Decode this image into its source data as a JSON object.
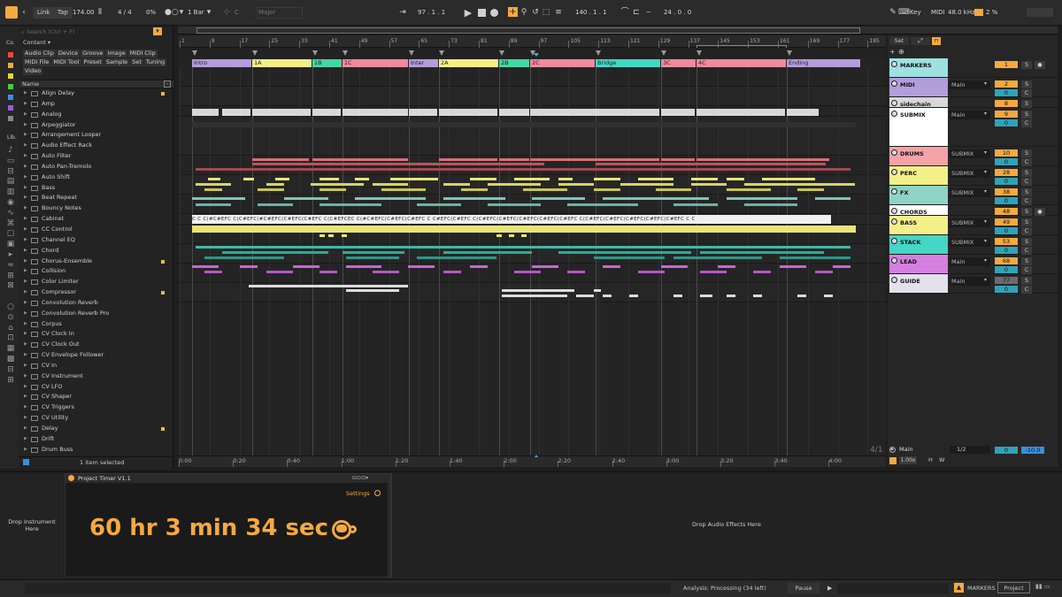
{
  "transport": {
    "link": "Link",
    "tap": "Tap",
    "tempo": "174.00",
    "meter": "4 / 4",
    "cpu": "0%",
    "quantize": "1 Bar",
    "key": "C",
    "scale": "Major",
    "position": "97 .  1 .  1",
    "loop_start": "140 .  1 .  1",
    "loop_length": "24 .  0 .  0",
    "key_label": "Key",
    "midi_label": "MIDI",
    "sample_rate": "48.0 kHz",
    "cpu_load": "2 %"
  },
  "browser": {
    "side_label": "Co.",
    "lib_label": "Lib.",
    "search_placeholder": "Search (Ctrl + F)",
    "content_label": "Content",
    "tags": [
      "Audio Clip",
      "Device",
      "Groove",
      "Image",
      "MIDI Clip",
      "MIDI File",
      "MIDI Tool",
      "Preset",
      "Sample",
      "Set",
      "Tuning",
      "Video"
    ],
    "name_header": "Name",
    "items": [
      {
        "label": "Align Delay",
        "dot": true
      },
      {
        "label": "Amp",
        "dot": false
      },
      {
        "label": "Analog",
        "dot": false
      },
      {
        "label": "Arpeggiator",
        "dot": false
      },
      {
        "label": "Arrangement Looper",
        "dot": false
      },
      {
        "label": "Audio Effect Rack",
        "dot": false
      },
      {
        "label": "Auto Filter",
        "dot": false
      },
      {
        "label": "Auto Pan-Tremolo",
        "dot": false
      },
      {
        "label": "Auto Shift",
        "dot": false
      },
      {
        "label": "Bass",
        "dot": false
      },
      {
        "label": "Beat Repeat",
        "dot": false
      },
      {
        "label": "Bouncy Notes",
        "dot": false
      },
      {
        "label": "Cabinet",
        "dot": false
      },
      {
        "label": "CC Control",
        "dot": false
      },
      {
        "label": "Channel EQ",
        "dot": false
      },
      {
        "label": "Chord",
        "dot": false
      },
      {
        "label": "Chorus-Ensemble",
        "dot": true
      },
      {
        "label": "Collision",
        "dot": false
      },
      {
        "label": "Color Limiter",
        "dot": false
      },
      {
        "label": "Compressor",
        "dot": true
      },
      {
        "label": "Convolution Reverb",
        "dot": false
      },
      {
        "label": "Convolution Reverb Pro",
        "dot": false
      },
      {
        "label": "Corpus",
        "dot": false
      },
      {
        "label": "CV Clock In",
        "dot": false
      },
      {
        "label": "CV Clock Out",
        "dot": false
      },
      {
        "label": "CV Envelope Follower",
        "dot": false
      },
      {
        "label": "CV In",
        "dot": false
      },
      {
        "label": "CV Instrument",
        "dot": false
      },
      {
        "label": "CV LFO",
        "dot": false
      },
      {
        "label": "CV Shaper",
        "dot": false
      },
      {
        "label": "CV Triggers",
        "dot": false
      },
      {
        "label": "CV Utility",
        "dot": false
      },
      {
        "label": "Delay",
        "dot": true
      },
      {
        "label": "Drift",
        "dot": false
      },
      {
        "label": "Drum Buss",
        "dot": false
      }
    ],
    "selected_status": "1 item selected"
  },
  "ruler": {
    "bars": [
      "1",
      "9",
      "17",
      "25",
      "33",
      "41",
      "49",
      "57",
      "65",
      "73",
      "81",
      "89",
      "97",
      "105",
      "113",
      "121",
      "129",
      "137",
      "145",
      "153",
      "161",
      "169",
      "177",
      "185"
    ],
    "times": [
      "0:00",
      "0:20",
      "0:40",
      "1:00",
      "1:20",
      "1:40",
      "2:00",
      "2:20",
      "2:40",
      "3:00",
      "3:20",
      "3:40",
      "4:00"
    ],
    "set_label": "Set"
  },
  "markers": [
    {
      "label": "Intro",
      "color": "#b39ddb"
    },
    {
      "label": "1A",
      "color": "#f3f08a"
    },
    {
      "label": "1B",
      "color": "#45d6a3"
    },
    {
      "label": "1C",
      "color": "#f08aa0"
    },
    {
      "label": "Inter",
      "color": "#b39ddb"
    },
    {
      "label": "2A",
      "color": "#f3f08a"
    },
    {
      "label": "2B",
      "color": "#45d6a3"
    },
    {
      "label": "2C",
      "color": "#f08aa0"
    },
    {
      "label": "Bridge",
      "color": "#45d6c6"
    },
    {
      "label": "3C",
      "color": "#f08aa0"
    },
    {
      "label": "4C",
      "color": "#f08aa0"
    },
    {
      "label": "Ending",
      "color": "#b39ddb"
    }
  ],
  "chord_strip": "C  C  C(#C#EFC C(C#EFC(#C#EFC(C#EFC(C#EFC C(C#EFCEC C(#C#EFC(C#EFC(C#EFC C  C#EFC(C#EFC C(C#EFC(C#EFC(C#EFC(C#EFC(C#EFC C(C#EFC(C#EFC(C#EFC(C#EFC(C#EFC C  C",
  "tracks": [
    {
      "name": "MARKERS",
      "color": "#9fe0e0",
      "route": "",
      "num": "1",
      "num_color": "#f5a93f",
      "sub": "",
      "has_c": false
    },
    {
      "name": "MIDI",
      "color": "#b39ddb",
      "route": "Main",
      "num": "2",
      "num_color": "#f5a93f",
      "sub": "0",
      "has_c": true
    },
    {
      "name": "sidechain",
      "color": "#d8d8d8",
      "route": "",
      "num": "8",
      "num_color": "#f5a93f",
      "sub": "",
      "has_c": false
    },
    {
      "name": "SUBMIX",
      "color": "#ffffff",
      "route": "Main",
      "num": "9",
      "num_color": "#f5a93f",
      "sub": "0",
      "has_c": true
    },
    {
      "name": "DRUMS",
      "color": "#f4a3a8",
      "route": "SUBMIX",
      "num": "10",
      "num_color": "#f5a93f",
      "sub": "0",
      "has_c": true
    },
    {
      "name": "PERC",
      "color": "#f3f08a",
      "route": "SUBMIX",
      "num": "28",
      "num_color": "#f5a93f",
      "sub": "0",
      "has_c": true
    },
    {
      "name": "FX",
      "color": "#8fd4c6",
      "route": "SUBMIX",
      "num": "38",
      "num_color": "#f5a93f",
      "sub": "0",
      "has_c": true
    },
    {
      "name": "CHORDS",
      "color": "#ffffff",
      "route": "",
      "num": "48",
      "num_color": "#f5a93f",
      "sub": "",
      "has_c": false
    },
    {
      "name": "BASS",
      "color": "#f3f08a",
      "route": "SUBMIX",
      "num": "49",
      "num_color": "#f5a93f",
      "sub": "0",
      "has_c": true
    },
    {
      "name": "STACK",
      "color": "#45d6c6",
      "route": "SUBMIX",
      "num": "53",
      "num_color": "#f5a93f",
      "sub": "0",
      "has_c": true
    },
    {
      "name": "LEAD",
      "color": "#d57fe0",
      "route": "Main",
      "num": "68",
      "num_color": "#f5a93f",
      "sub": "0",
      "has_c": true
    },
    {
      "name": "GUIDE",
      "color": "#e4e0ee",
      "route": "Main",
      "num": "77",
      "num_color": "#6b6b6b",
      "sub": "0",
      "has_c": true
    }
  ],
  "main_track": {
    "meter": "4/1",
    "name": "Main",
    "ratio": "1/2",
    "vol_a": "0",
    "vol_b": "-10.0",
    "zoom": "1.00x",
    "h": "H",
    "w": "W"
  },
  "device": {
    "drop_instrument": "Drop Instrument Here",
    "title": "Project Timer V1.1",
    "settings": "Settings",
    "time": "60 hr 3 min 34 sec",
    "drop_effects": "Drop Audio Effects Here"
  },
  "status": {
    "analysis": "Analysis: Processing (34 left)",
    "pause": "Pause",
    "track_name": "MARKERS",
    "device_tab": "Project Tim"
  }
}
